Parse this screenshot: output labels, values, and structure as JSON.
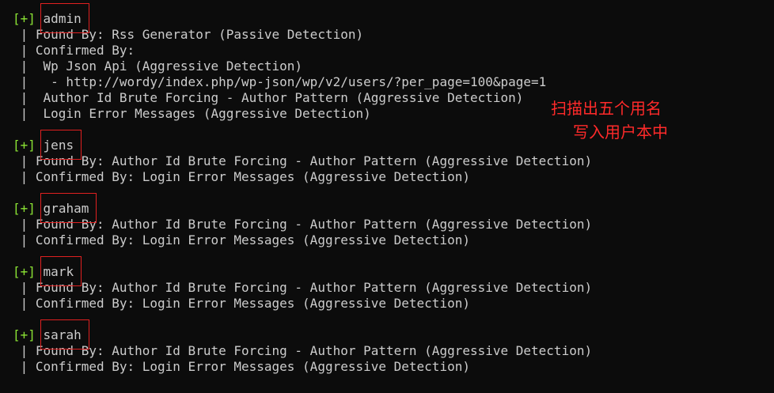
{
  "users": [
    {
      "name": "admin",
      "details": [
        " | Found By: Rss Generator (Passive Detection)",
        " | Confirmed By:",
        " |  Wp Json Api (Aggressive Detection)",
        " |   - http://wordy/index.php/wp-json/wp/v2/users/?per_page=100&page=1",
        " |  Author Id Brute Forcing - Author Pattern (Aggressive Detection)",
        " |  Login Error Messages (Aggressive Detection)"
      ]
    },
    {
      "name": "jens",
      "details": [
        " | Found By: Author Id Brute Forcing - Author Pattern (Aggressive Detection)",
        " | Confirmed By: Login Error Messages (Aggressive Detection)"
      ]
    },
    {
      "name": "graham",
      "details": [
        " | Found By: Author Id Brute Forcing - Author Pattern (Aggressive Detection)",
        " | Confirmed By: Login Error Messages (Aggressive Detection)"
      ]
    },
    {
      "name": "mark",
      "details": [
        " | Found By: Author Id Brute Forcing - Author Pattern (Aggressive Detection)",
        " | Confirmed By: Login Error Messages (Aggressive Detection)"
      ]
    },
    {
      "name": "sarah",
      "details": [
        " | Found By: Author Id Brute Forcing - Author Pattern (Aggressive Detection)",
        " | Confirmed By: Login Error Messages (Aggressive Detection)"
      ]
    }
  ],
  "prefix": "[+]",
  "annotation": {
    "line1": "扫描出五个用名",
    "line2": "写入用户本中"
  },
  "colors": {
    "background": "#0c0c0c",
    "text": "#cccccc",
    "prefix": "#8ae234",
    "annotation": "#ff2a2a"
  }
}
